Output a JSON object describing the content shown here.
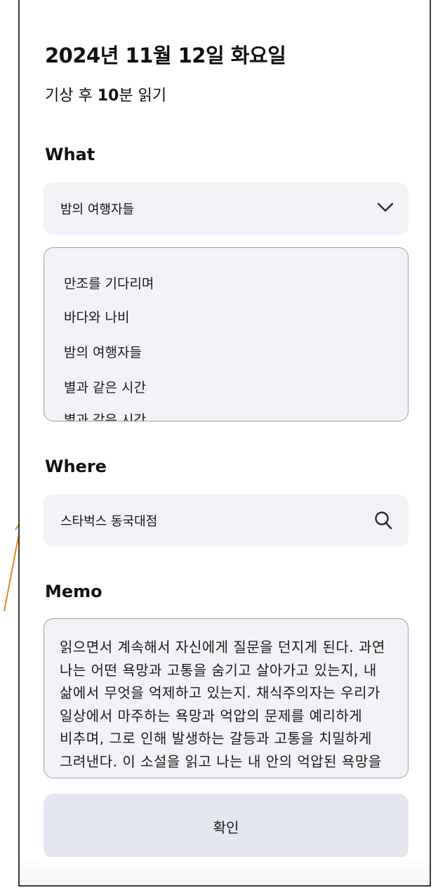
{
  "header": {
    "date_title": "2024년 11월 12일 화요일",
    "subtitle_prefix": "기상 후 ",
    "subtitle_number": "10",
    "subtitle_suffix": "분 읽기"
  },
  "what": {
    "label": "What",
    "selected": "밤의 여행자들",
    "icon": "chevron-down-icon",
    "options": [
      "만조를 기다리며",
      "바다와 나비",
      "밤의 여행자들",
      "별과 같은 시간",
      "별과 같은 시간"
    ]
  },
  "where": {
    "label": "Where",
    "value": "스타벅스 동국대점",
    "icon": "search-icon"
  },
  "memo": {
    "label": "Memo",
    "text": "읽으면서 계속해서 자신에게 질문을 던지게 된다. 과연 나는 어떤 욕망과 고통을 숨기고 살아가고 있는지, 내 삶에서 무엇을 억제하고 있는지. 채식주의자는 우리가 일상에서 마주하는 욕망과 억압의 문제를 예리하게 비추며, 그로 인해 발생하는 갈등과 고통을 치밀하게 그려낸다. 이 소설을 읽고 나는 내 안의 억압된 욕망을 마주하게 되었다."
  },
  "confirm_button": {
    "label": "확인"
  },
  "colors": {
    "field_background": "#f2f3f6",
    "field_border": "#9aa0b6",
    "button_background": "#e4e7ef",
    "annotation_arrow": "#e08a1e"
  }
}
